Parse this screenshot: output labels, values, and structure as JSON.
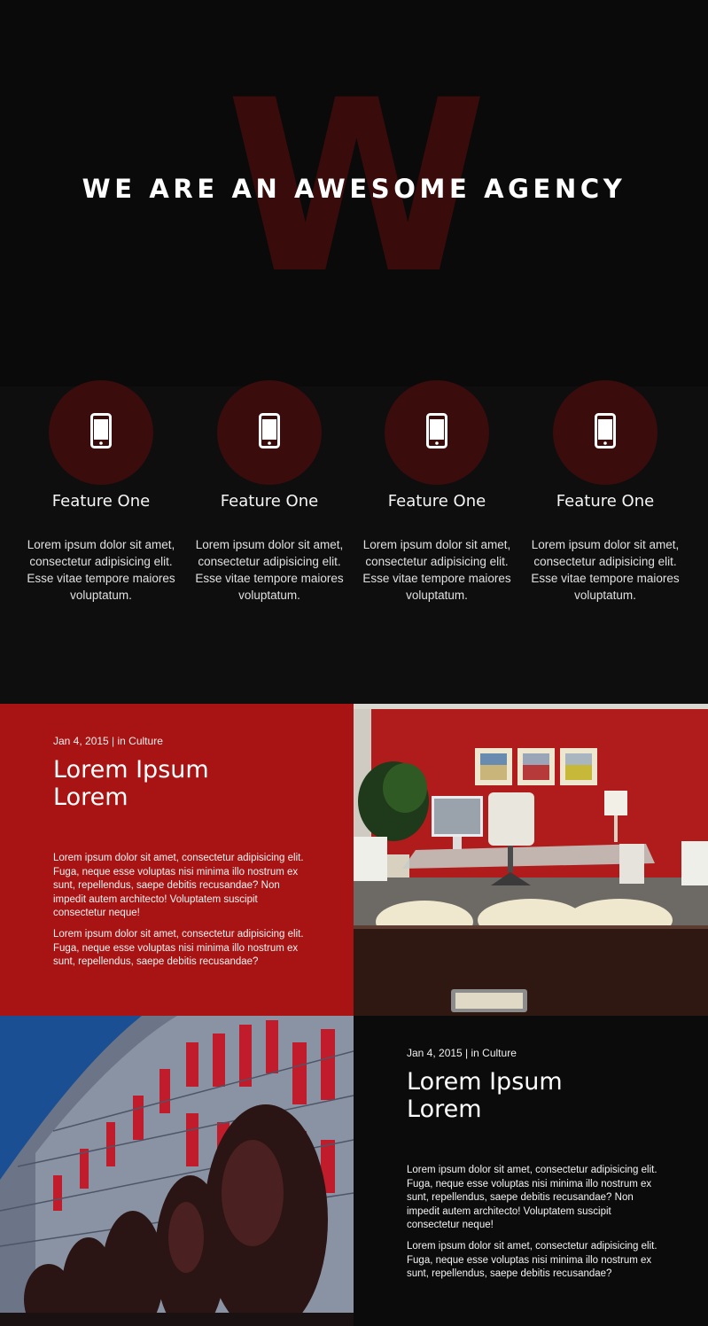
{
  "colors": {
    "background": "#0b0b0b",
    "accent": "#a81414",
    "feature_circle": "#3a0c0c",
    "hero_letter": "#3a0b0b"
  },
  "hero": {
    "title": "WE ARE AN AWESOME AGENCY",
    "background_letter": "W"
  },
  "features": [
    {
      "icon": "smartphone-icon",
      "title": "Feature One",
      "text": "Lorem ipsum dolor sit amet, consectetur adipisicing elit. Esse vitae tempore maiores voluptatum."
    },
    {
      "icon": "smartphone-icon",
      "title": "Feature One",
      "text": "Lorem ipsum dolor sit amet, consectetur adipisicing elit. Esse vitae tempore maiores voluptatum."
    },
    {
      "icon": "smartphone-icon",
      "title": "Feature One",
      "text": "Lorem ipsum dolor sit amet, consectetur adipisicing elit. Esse vitae tempore maiores voluptatum."
    },
    {
      "icon": "smartphone-icon",
      "title": "Feature One",
      "text": "Lorem ipsum dolor sit amet, consectetur adipisicing elit. Esse vitae tempore maiores voluptatum."
    }
  ],
  "posts": [
    {
      "meta": "Jan 4, 2015 | in Culture",
      "title": "Lorem Ipsum Lorem",
      "paragraph1": "Lorem ipsum dolor sit amet, consectetur adipisicing elit. Fuga, neque esse voluptas nisi minima illo nostrum ex sunt, repellendus, saepe debitis recusandae? Non impedit autem architecto! Voluptatem suscipit consectetur neque!",
      "paragraph2": "Lorem ipsum dolor sit amet, consectetur adipisicing elit. Fuga, neque esse voluptas nisi minima illo nostrum ex sunt, repellendus, saepe debitis recusandae?",
      "image": "office-photo"
    },
    {
      "meta": "Jan 4, 2015 | in Culture",
      "title": "Lorem Ipsum Lorem",
      "paragraph1": "Lorem ipsum dolor sit amet, consectetur adipisicing elit. Fuga, neque esse voluptas nisi minima illo nostrum ex sunt, repellendus, saepe debitis recusandae? Non impedit autem architecto! Voluptatem suscipit consectetur neque!",
      "paragraph2": "Lorem ipsum dolor sit amet, consectetur adipisicing elit. Fuga, neque esse voluptas nisi minima illo nostrum ex sunt, repellendus, saepe debitis recusandae?",
      "image": "building-photo"
    }
  ]
}
